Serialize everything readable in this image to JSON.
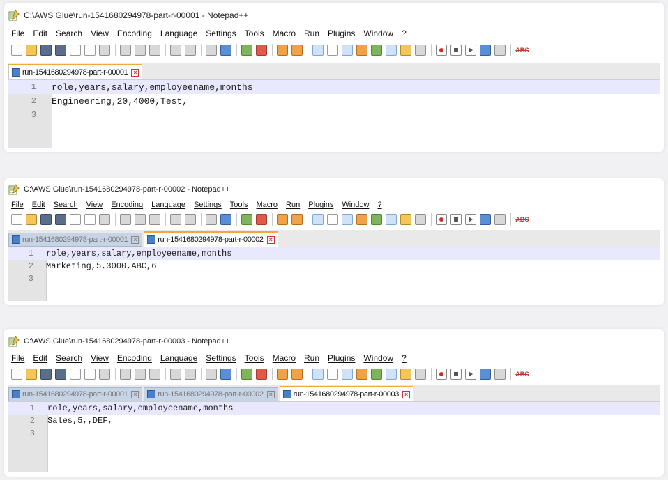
{
  "menus": [
    "File",
    "Edit",
    "Search",
    "View",
    "Encoding",
    "Language",
    "Settings",
    "Tools",
    "Macro",
    "Run",
    "Plugins",
    "Window",
    "?"
  ],
  "toolbar_icons": [
    "new-file-icon",
    "open-file-icon",
    "save-icon",
    "save-all-icon",
    "close-icon",
    "close-all-icon",
    "print-icon",
    "cut-icon",
    "copy-icon",
    "paste-icon",
    "undo-icon",
    "redo-icon",
    "find-icon",
    "replace-icon",
    "zoom-in-icon",
    "zoom-out-icon",
    "sync-vertical-icon",
    "sync-horizontal-icon",
    "word-wrap-icon",
    "show-all-chars-icon",
    "indent-guide-icon",
    "udl-icon",
    "doc-map-icon",
    "function-list-icon",
    "folder-workspace-icon",
    "monitoring-icon",
    "record-macro-icon",
    "stop-record-icon",
    "playback-macro-icon",
    "run-macro-multiple-icon",
    "save-macro-icon",
    "spell-check-icon"
  ],
  "spellcheck_label": "ABC",
  "colors": {
    "active_tab_accent": "#f4a83b",
    "current_line": "#e8e8ff",
    "gutter": "#e4e4e4"
  },
  "windows": [
    {
      "title": "C:\\AWS Glue\\run-1541680294978-part-r-00001 - Notepad++",
      "tabs": [
        {
          "label": "run-1541680294978-part-r-00001",
          "active": true
        }
      ],
      "lines": [
        {
          "num": "1",
          "text": "role,years,salary,employeename,months"
        },
        {
          "num": "2",
          "text": "Engineering,20,4000,Test,"
        },
        {
          "num": "3",
          "text": ""
        }
      ]
    },
    {
      "title": "C:\\AWS Glue\\run-1541680294978-part-r-00002 - Notepad++",
      "tabs": [
        {
          "label": "run-1541680294978-part-r-00001",
          "active": false
        },
        {
          "label": "run-1541680294978-part-r-00002",
          "active": true
        }
      ],
      "lines": [
        {
          "num": "1",
          "text": "role,years,salary,employeename,months"
        },
        {
          "num": "2",
          "text": "Marketing,5,3000,ABC,6"
        },
        {
          "num": "3",
          "text": ""
        }
      ]
    },
    {
      "title": "C:\\AWS Glue\\run-1541680294978-part-r-00003 - Notepad++",
      "tabs": [
        {
          "label": "run-1541680294978-part-r-00001",
          "active": false
        },
        {
          "label": "run-1541680294978-part-r-00002",
          "active": false
        },
        {
          "label": "run-1541680294978-part-r-00003",
          "active": true
        }
      ],
      "lines": [
        {
          "num": "1",
          "text": "role,years,salary,employeename,months"
        },
        {
          "num": "2",
          "text": "Sales,5,,DEF,"
        },
        {
          "num": "3",
          "text": ""
        }
      ]
    }
  ]
}
